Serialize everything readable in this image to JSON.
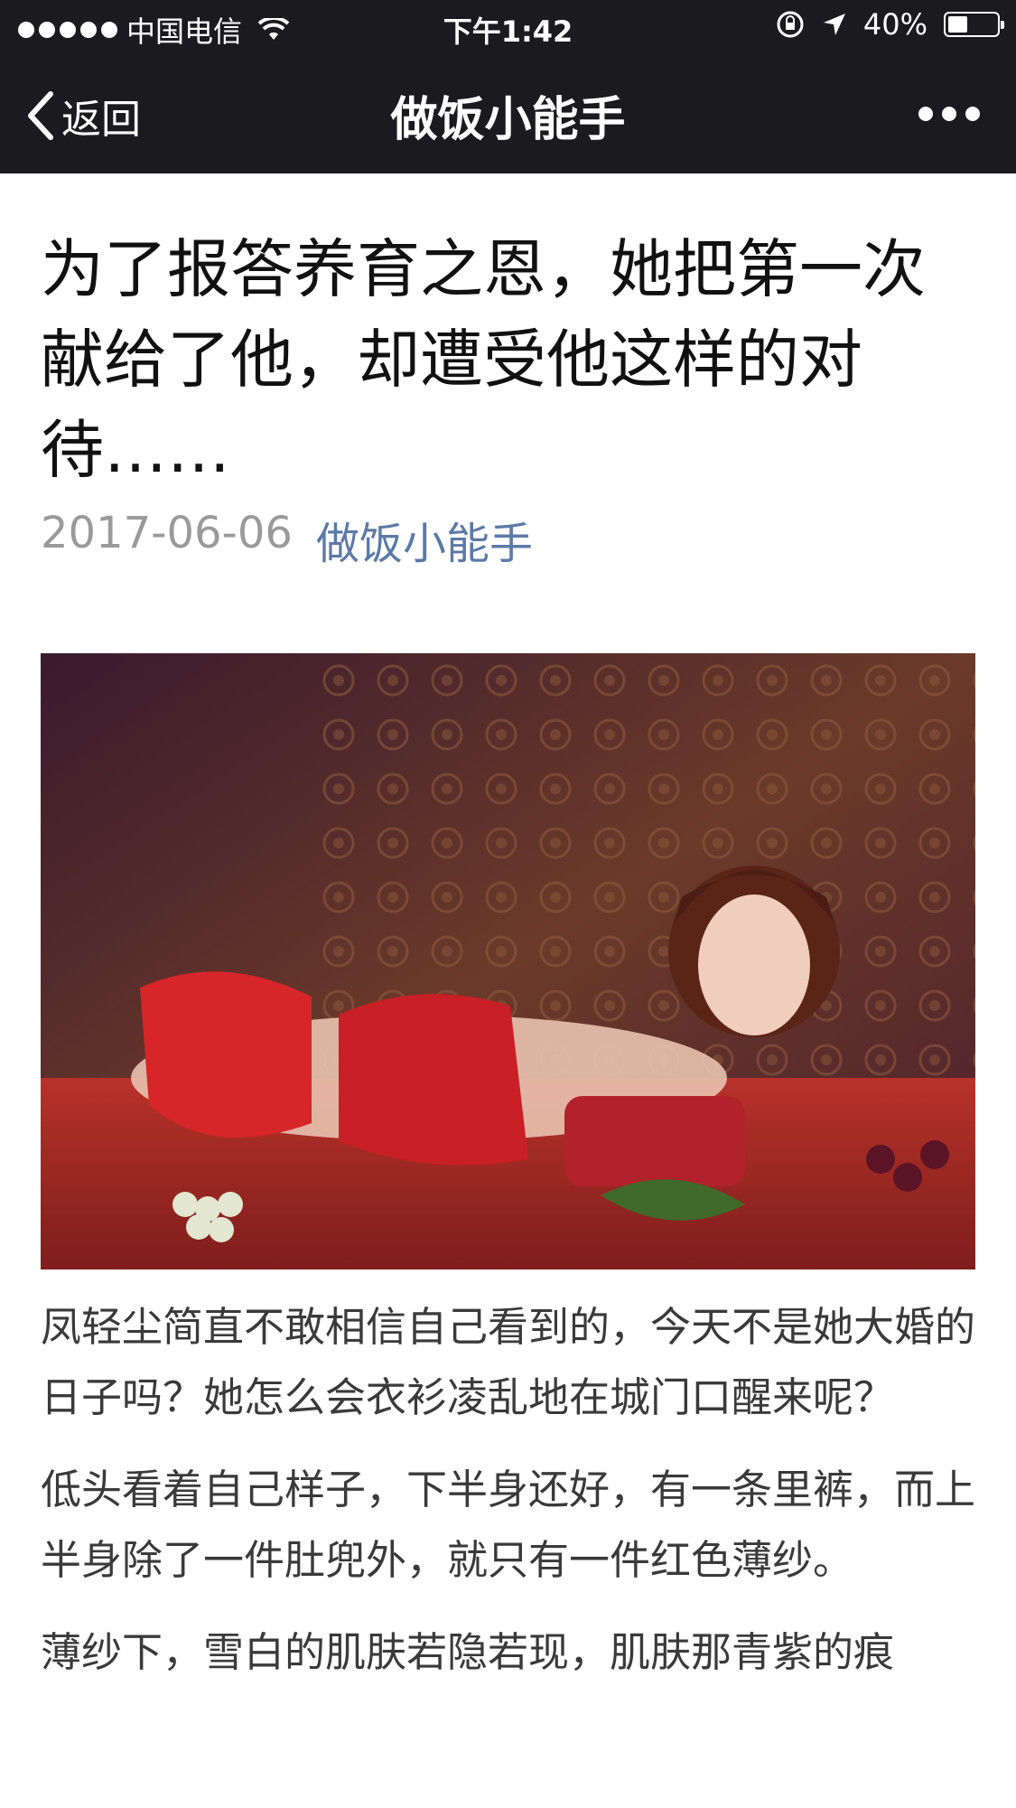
{
  "status_bar": {
    "carrier": "中国电信",
    "time": "下午1:42",
    "battery_text": "40%",
    "battery_level": 0.4
  },
  "nav": {
    "back_label": "返回",
    "title": "做饭小能手"
  },
  "article": {
    "title": "为了报答养育之恩，她把第一次献给了他，却遭受他这样的对待……",
    "date": "2017-06-06",
    "author": "做饭小能手",
    "paragraphs": [
      "凤轻尘简直不敢相信自己看到的，今天不是她大婚的日子吗？她怎么会衣衫凌乱地在城门口醒来呢？",
      "低头看着自己样子，下半身还好，有一条里裤，而上半身除了一件肚兜外，就只有一件红色薄纱。",
      "薄纱下，雪白的肌肤若隐若现，肌肤那青紫的痕"
    ]
  },
  "colors": {
    "bar_bg": "#1b1a1f",
    "author_link": "#5d7aa6",
    "meta_gray": "#9a9a9a"
  }
}
